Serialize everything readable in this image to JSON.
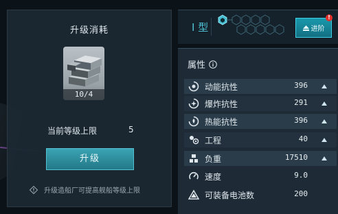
{
  "left_panel": {
    "title": "升级消耗",
    "item": {
      "count_label": "10/4",
      "icon": "metal-ingots-icon"
    },
    "level_label": "当前等级上限",
    "level_value": "5",
    "upgrade_button": "升级",
    "hint": "升级造船厂可提高舰船等级上限"
  },
  "right_top": {
    "type_label": "I 型",
    "advance_button": "进阶",
    "badge": "!"
  },
  "attributes": {
    "header": "属性",
    "rows": [
      {
        "icon": "kinetic-resist-icon",
        "name": "动能抗性",
        "value": "396",
        "arrow": true
      },
      {
        "icon": "explosive-resist-icon",
        "name": "爆炸抗性",
        "value": "291",
        "arrow": true
      },
      {
        "icon": "thermal-resist-icon",
        "name": "热能抗性",
        "value": "396",
        "arrow": true
      },
      {
        "icon": "engineering-icon",
        "name": "工程",
        "value": "40",
        "arrow": true
      },
      {
        "icon": "load-icon",
        "name": "负重",
        "value": "17510",
        "arrow": true
      },
      {
        "icon": "speed-icon",
        "name": "速度",
        "value": "9.0",
        "arrow": false
      },
      {
        "icon": "battery-slots-icon",
        "name": "可装备电池数",
        "value": "200",
        "arrow": false
      }
    ]
  },
  "colors": {
    "accent": "#4fc3d5",
    "button": "#237887",
    "badge": "#e0312c"
  }
}
